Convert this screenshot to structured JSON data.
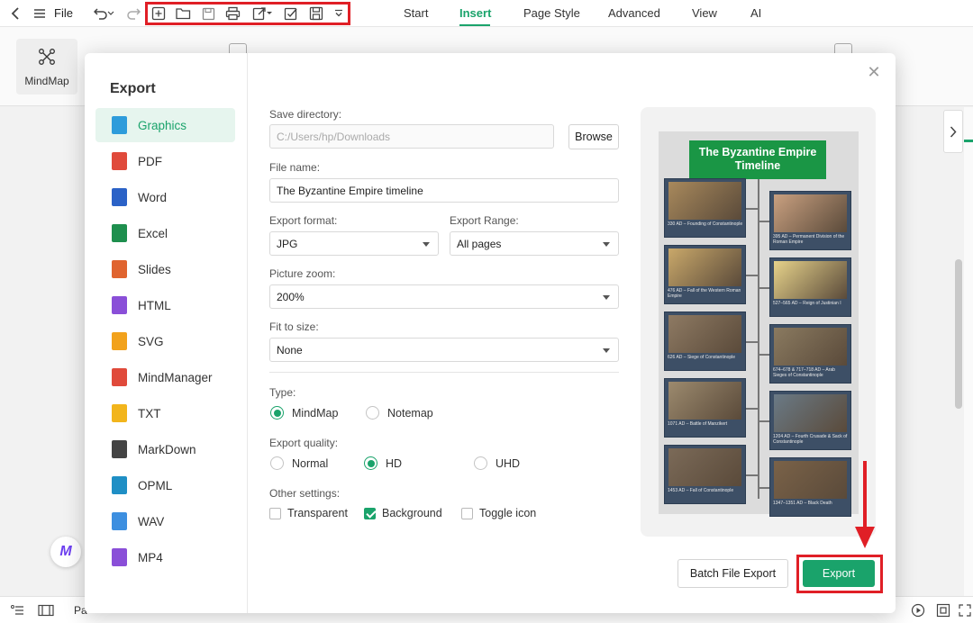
{
  "menubar": {
    "file_label": "File",
    "tabs": [
      {
        "label": "Start"
      },
      {
        "label": "Insert"
      },
      {
        "label": "Page Style"
      },
      {
        "label": "Advanced"
      },
      {
        "label": "View"
      },
      {
        "label": "AI"
      }
    ],
    "active_tab": "Insert",
    "accent_color": "#1aa36b"
  },
  "ribbon": {
    "mindmap_label": "MindMap"
  },
  "statusbar": {
    "page_label": "Pa"
  },
  "dialog": {
    "title": "Export",
    "formats": [
      {
        "label": "Graphics",
        "icon": "image-file-icon",
        "color": "#2e9cdb"
      },
      {
        "label": "PDF",
        "icon": "pdf-file-icon",
        "color": "#e04a3b"
      },
      {
        "label": "Word",
        "icon": "word-file-icon",
        "color": "#2b62c7"
      },
      {
        "label": "Excel",
        "icon": "excel-file-icon",
        "color": "#1e8f4e"
      },
      {
        "label": "Slides",
        "icon": "slides-file-icon",
        "color": "#e0642f"
      },
      {
        "label": "HTML",
        "icon": "html-file-icon",
        "color": "#8a4fd8"
      },
      {
        "label": "SVG",
        "icon": "svg-file-icon",
        "color": "#f2a21c"
      },
      {
        "label": "MindManager",
        "icon": "mindmanager-file-icon",
        "color": "#e04a3b"
      },
      {
        "label": "TXT",
        "icon": "txt-file-icon",
        "color": "#f2b51c"
      },
      {
        "label": "MarkDown",
        "icon": "markdown-file-icon",
        "color": "#444444"
      },
      {
        "label": "OPML",
        "icon": "opml-file-icon",
        "color": "#1f8fc5"
      },
      {
        "label": "WAV",
        "icon": "wav-file-icon",
        "color": "#3d8fe0"
      },
      {
        "label": "MP4",
        "icon": "mp4-file-icon",
        "color": "#8a4fd8"
      }
    ],
    "active_format": "Graphics",
    "save_directory": {
      "label": "Save directory:",
      "value": "C:/Users/hp/Downloads"
    },
    "browse_label": "Browse",
    "file_name": {
      "label": "File name:",
      "value": "The Byzantine Empire timeline"
    },
    "export_format": {
      "label": "Export format:",
      "value": "JPG"
    },
    "export_range": {
      "label": "Export Range:",
      "value": "All pages"
    },
    "picture_zoom": {
      "label": "Picture zoom:",
      "value": "200%"
    },
    "fit_to_size": {
      "label": "Fit to size:",
      "value": "None"
    },
    "type": {
      "label": "Type:",
      "options": [
        "MindMap",
        "Notemap"
      ],
      "selected": "MindMap"
    },
    "quality": {
      "label": "Export quality:",
      "options": [
        "Normal",
        "HD",
        "UHD"
      ],
      "selected": "HD"
    },
    "other": {
      "label": "Other settings:",
      "options": [
        {
          "label": "Transparent",
          "checked": false
        },
        {
          "label": "Background",
          "checked": true
        },
        {
          "label": "Toggle icon",
          "checked": false
        }
      ]
    },
    "batch_export_label": "Batch File Export",
    "export_label": "Export"
  },
  "preview": {
    "title": "The Byzantine Empire Timeline",
    "left_events": [
      "330 AD – Founding of Constantinople",
      "476 AD – Fall of the Western Roman Empire",
      "626 AD – Siege of Constantinople",
      "1071 AD – Battle of Manzikert",
      "1453 AD – Fall of Constantinople"
    ],
    "right_events": [
      "395 AD – Permanent Division of the Roman Empire",
      "527–565 AD – Reign of Justinian I",
      "674–678 & 717–718 AD – Arab Sieges of Constantinople",
      "1204 AD – Fourth Crusade & Sack of Constantinople",
      "1347–1351 AD – Black Death"
    ]
  }
}
